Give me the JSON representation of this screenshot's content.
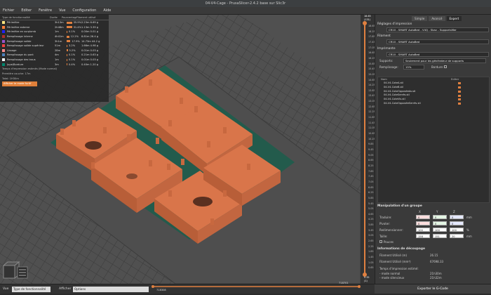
{
  "window": {
    "title": "04-V4-Cage - PrusaSlicer-2.4.2 base sur Slic3r"
  },
  "menu": [
    "Fichier",
    "Editer",
    "Fenêtre",
    "Vue",
    "Configuration",
    "Aide"
  ],
  "legend": {
    "headers": [
      "Type de fonctionnalité",
      "Durée",
      "Pourcentage",
      "Filament utilisé"
    ],
    "rows": [
      {
        "name": "Périmètre",
        "time": "3h13m",
        "pct": "35.9%",
        "fil": "2.23m   6.69 g",
        "color": "#ffe680",
        "bar": 0.36
      },
      {
        "name": "Périmètre externe",
        "time": "2h48m",
        "pct": "31.4%",
        "fil": "1.13m   3.39 g",
        "color": "#ff7d38",
        "bar": 0.31
      },
      {
        "name": "Périmètre en surplomb",
        "time": "1m",
        "pct": "0.1%",
        "fil": "0.00m   0.01 g",
        "color": "#1f1fff",
        "bar": 0.0
      },
      {
        "name": "Remplissage interne",
        "time": "4h41m",
        "pct": "12.2%",
        "fil": "8.81m   26.4 g",
        "color": "#b03029",
        "bar": 0.12
      },
      {
        "name": "Remplissage solide",
        "time": "3h1m",
        "pct": "17.9%",
        "fil": "14.73m  44.2 g",
        "color": "#9654cc",
        "bar": 0.18
      },
      {
        "name": "Remplissage solide supérieur",
        "time": "51m",
        "pct": "3.2%",
        "fil": "1.66m   4.98 g",
        "color": "#f04040",
        "bar": 0.03
      },
      {
        "name": "Lissage",
        "time": "28m",
        "pct": "5.2%",
        "fil": "0.01m   0.03 g",
        "color": "#ff8d8d",
        "bar": 0.05
      },
      {
        "name": "Remplissage du pont",
        "time": "4m",
        "pct": "0.1%",
        "fil": "0.21m   0.63 g",
        "color": "#4d80ba",
        "bar": 0.0
      },
      {
        "name": "Remplissage des trous",
        "time": "1m",
        "pct": "0.1%",
        "fil": "0.01m   0.03 g",
        "color": "#ffffff",
        "bar": 0.0
      },
      {
        "name": "Jupe/Bordure",
        "time": "3m",
        "pct": "0.4%",
        "fil": "0.40m   1.20 g",
        "color": "#00876e",
        "bar": 0.0
      }
    ],
    "estimate": "Temps d'impression estimés (Mode normal)",
    "first_layer_label": "Première couche",
    "first_layer": "17m",
    "total_label": "Total",
    "total": "1H30m",
    "show_button": "Afficher le mode furtif"
  },
  "bottom": {
    "view_label": "Vue",
    "view_value": "Type de fonctionnalité",
    "show_label": "Afficher",
    "show_value": "Options",
    "slider_left": "718308",
    "slider_right": "718701"
  },
  "vslider": {
    "top": "18.65",
    "top2": "(131)",
    "bottom": "0.35",
    "bottom2": "(1)",
    "ticks": [
      "18.65",
      "18.25",
      "17.85",
      "17.45",
      "17.05",
      "16.65",
      "16.25",
      "15.85",
      "15.45",
      "15.05",
      "14.65",
      "14.25",
      "13.85",
      "13.45",
      "13.05",
      "12.65",
      "12.25",
      "11.85",
      "11.45",
      "11.05",
      "10.65",
      "10.25",
      "9.85",
      "9.45",
      "9.05",
      "8.65",
      "8.25",
      "7.85",
      "7.45",
      "7.05",
      "6.65",
      "6.25",
      "5.85",
      "5.45",
      "5.05",
      "4.65",
      "4.25",
      "3.85",
      "3.45",
      "3.05",
      "2.65",
      "2.25",
      "1.85",
      "1.45",
      "1.05",
      "0.65"
    ]
  },
  "panel": {
    "tabs": [
      "Simple",
      "Avancé",
      "Expert"
    ],
    "print_settings_label": "Réglages d'impression",
    "print_settings": "CR10 - SMART AutoBed - V4Q - Skav - SupportsMer",
    "filament_label": "Filament",
    "filament": "CR10 - SMART AutoBed",
    "printer_label": "Imprimante",
    "printer": "CR10 - SMART AutoBed",
    "supports_label": "Supports:",
    "supports": "Seulement pour les générateur de supports",
    "infill_label": "Remplissage:",
    "infill": "15%",
    "brim_label": "Bordure:",
    "list_name": "Nom",
    "list_edit": "Editer",
    "objects": [
      "04-V4-CoteA.stl",
      "04-V4-CoteB.stl",
      "04-V4-CoteOpposéeAv.stl",
      "04-V4-CoteSerrés.stl",
      "04-V4-CoteVis.stl",
      "04-V4-CoteOpposéeSerrés.stl"
    ],
    "manip_title": "Manipulation d'un groupe",
    "axes": [
      "X",
      "Y",
      "Z"
    ],
    "position_label": "Traduire:",
    "position": [
      "0",
      "0",
      "0"
    ],
    "position_unit": "mm",
    "rotation_label": "Pivoter:",
    "rotation": [
      "0",
      "0",
      "0"
    ],
    "scale_label": "Redimensionner:",
    "scale": [
      "100",
      "100",
      "100"
    ],
    "scale_unit": "%",
    "size_label": "Taille:",
    "size": [
      "158",
      "151",
      "20"
    ],
    "size_unit": "mm",
    "inches_label": "Pouces",
    "slice_title": "Informations de découpage",
    "fil_m_label": "Filament Utilisé (m)",
    "fil_m": "26.15",
    "fil_mm3_label": "Filament Utilisé (mm³)",
    "fil_mm3": "67698.33",
    "time_label": "Temps d'impression estimé:",
    "normal_label": "- mode normal",
    "normal": "21h30m",
    "silent_label": "- mode silencieux",
    "silent": "21h32m",
    "export": "Exporter le G-Code"
  }
}
